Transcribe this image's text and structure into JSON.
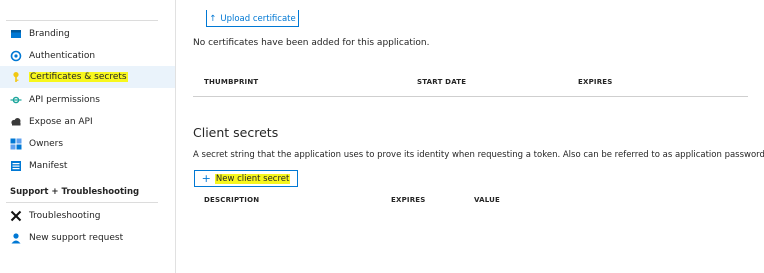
{
  "sidebar": {
    "items": [
      {
        "label": "Branding",
        "icon": "branding-icon"
      },
      {
        "label": "Authentication",
        "icon": "authentication-icon"
      },
      {
        "label": "Certificates & secrets",
        "icon": "key-icon",
        "selected": true
      },
      {
        "label": "API permissions",
        "icon": "api-permissions-icon"
      },
      {
        "label": "Expose an API",
        "icon": "cloud-icon"
      },
      {
        "label": "Owners",
        "icon": "owners-icon"
      },
      {
        "label": "Manifest",
        "icon": "manifest-icon"
      }
    ],
    "support_header": "Support + Troubleshooting",
    "support_items": [
      {
        "label": "Troubleshooting",
        "icon": "tools-icon"
      },
      {
        "label": "New support request",
        "icon": "support-icon"
      }
    ]
  },
  "certificates": {
    "upload_label": "Upload certificate",
    "empty_message": "No certificates have been added for this application.",
    "columns": [
      "THUMBPRINT",
      "START DATE",
      "EXPIRES"
    ]
  },
  "client_secrets": {
    "title": "Client secrets",
    "description": "A secret string that the application uses to prove its identity when requesting a token. Also can be referred to as application password.",
    "new_label": "New client secret",
    "columns": [
      "DESCRIPTION",
      "EXPIRES",
      "VALUE"
    ]
  },
  "colors": {
    "accent": "#0078d4",
    "highlight": "#f7f71e",
    "selected_bg": "#eaf3fb"
  }
}
